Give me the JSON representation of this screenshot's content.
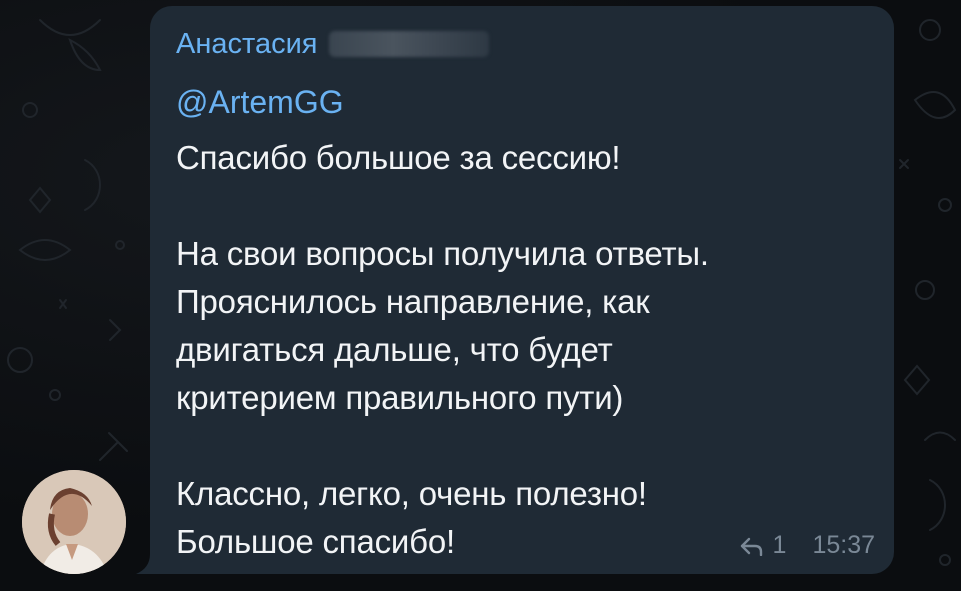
{
  "message": {
    "sender_name": "Анастасия",
    "mention": "@ArtemGG",
    "lines_block1": [
      "Спасибо большое за сессию!"
    ],
    "lines_block2": [
      "На свои вопросы получила ответы.",
      "Прояснилось направление, как",
      "двигаться дальше, что будет",
      "критерием правильного пути)"
    ],
    "lines_block3": [
      "Классно, легко, очень полезно!",
      "Большое спасибо!"
    ],
    "reply_count": "1",
    "time": "15:37",
    "reply_icon": "reply-arrow-icon"
  },
  "colors": {
    "bubble": "#1f2a35",
    "sender": "#6ab2f2",
    "text": "#f2f4f6",
    "meta": "#7a8896",
    "background": "#0b0d10"
  }
}
